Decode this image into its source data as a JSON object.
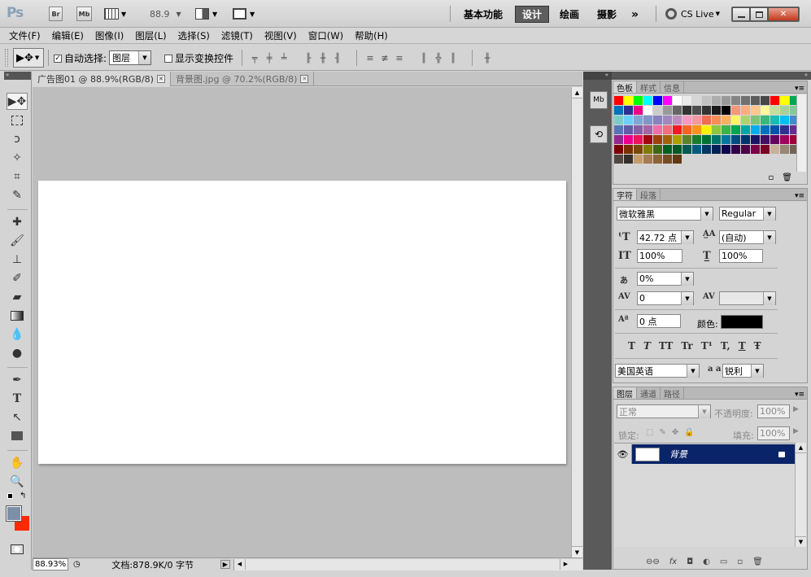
{
  "app": {
    "logo": "Ps",
    "br": "Br",
    "mb": "Mb",
    "zoom": "88.9",
    "workspaces": [
      "基本功能",
      "设计",
      "绘画",
      "摄影"
    ],
    "more": "»",
    "cslive": "CS Live"
  },
  "menu": [
    "文件(F)",
    "编辑(E)",
    "图像(I)",
    "图层(L)",
    "选择(S)",
    "滤镜(T)",
    "视图(V)",
    "窗口(W)",
    "帮助(H)"
  ],
  "options": {
    "auto_select_label": "自动选择:",
    "auto_select_checked": true,
    "auto_select_value": "图层",
    "show_transform_label": "显示变换控件"
  },
  "tabs": [
    {
      "label": "广告图01 @ 88.9%(RGB/8)",
      "active": true
    },
    {
      "label": "背景图.jpg @ 70.2%(RGB/8)",
      "active": false
    }
  ],
  "status": {
    "zoom": "88.93%",
    "doc": "文档:878.9K/0 字节"
  },
  "swatch_panel": {
    "tabs": [
      "色板",
      "样式",
      "信息"
    ]
  },
  "swatch_colors": [
    "#ff0000",
    "#ffff00",
    "#00ff00",
    "#00ffff",
    "#0000ff",
    "#ff00ff",
    "#ffffff",
    "#ebebeb",
    "#d6d6d6",
    "#c2c2c2",
    "#adadad",
    "#999999",
    "#858585",
    "#707070",
    "#5c5c5c",
    "#474747",
    "#ff0000",
    "#ffff00",
    "#00a651",
    "#0072bc",
    "#2e3192",
    "#ec008c",
    "#ffffff",
    "#cccccc",
    "#999999",
    "#666666",
    "#333333",
    "#4d4d4d",
    "#333333",
    "#1a1a1a",
    "#000000",
    "#f7977a",
    "#f9ad81",
    "#fdc68a",
    "#fff79a",
    "#c4df9b",
    "#a3d39c",
    "#82ca9d",
    "#7bcdc8",
    "#6dcff6",
    "#7ea7d8",
    "#8493ca",
    "#8882be",
    "#a187be",
    "#bc8dbf",
    "#f49ac2",
    "#f6989d",
    "#f26c4f",
    "#f68e55",
    "#fbaf5c",
    "#fff467",
    "#acd372",
    "#7cc576",
    "#3bb878",
    "#1abbb4",
    "#00bff3",
    "#438ccb",
    "#5574b9",
    "#605ca8",
    "#855fa8",
    "#a763a8",
    "#f06ea9",
    "#f26d7d",
    "#ed1c24",
    "#f26522",
    "#f7941d",
    "#fff200",
    "#8dc73f",
    "#39b54a",
    "#00a651",
    "#00a99d",
    "#00aeef",
    "#0072bc",
    "#0054a6",
    "#2e3192",
    "#662d91",
    "#92278f",
    "#ec008c",
    "#ed145b",
    "#9e0b0f",
    "#a0410d",
    "#a36209",
    "#aba000",
    "#598527",
    "#197b30",
    "#007236",
    "#00746b",
    "#0076a3",
    "#004b80",
    "#003471",
    "#1b1464",
    "#440e62",
    "#630460",
    "#9e005d",
    "#9e0039",
    "#790000",
    "#7b2e00",
    "#7d4900",
    "#827b00",
    "#406618",
    "#005e20",
    "#005826",
    "#005952",
    "#005b7f",
    "#003663",
    "#002157",
    "#0d004c",
    "#32004b",
    "#4b0049",
    "#7b0046",
    "#7a0026",
    "#c7b299",
    "#998675",
    "#736357",
    "#534741",
    "#37302a",
    "#c69c6d",
    "#a67c52",
    "#8c6239",
    "#754c24",
    "#603913"
  ],
  "char_panel": {
    "tabs": [
      "字符",
      "段落"
    ],
    "font": "微软雅黑",
    "style": "Regular",
    "size": "42.72 点",
    "leading": "(自动)",
    "vscale": "100%",
    "hscale": "100%",
    "tsume": "0%",
    "kerning": "0",
    "tracking": "",
    "baseline": "0 点",
    "color_label": "颜色:",
    "color": "#000000",
    "language": "美国英语",
    "aa_label": "a a",
    "aa": "锐利",
    "styles": [
      "T",
      "T",
      "TT",
      "Tr",
      "T¹",
      "T,",
      "T",
      "Ŧ"
    ]
  },
  "layers_panel": {
    "tabs": [
      "图层",
      "通道",
      "路径"
    ],
    "blend": "正常",
    "opacity_label": "不透明度:",
    "opacity": "100%",
    "lock_label": "锁定:",
    "fill_label": "填充:",
    "fill": "100%",
    "layers": [
      {
        "name": "背景"
      }
    ]
  },
  "colors": {
    "accent": "#0a246a",
    "fg": "#7d8fa6",
    "bg": "#ff2a00"
  }
}
